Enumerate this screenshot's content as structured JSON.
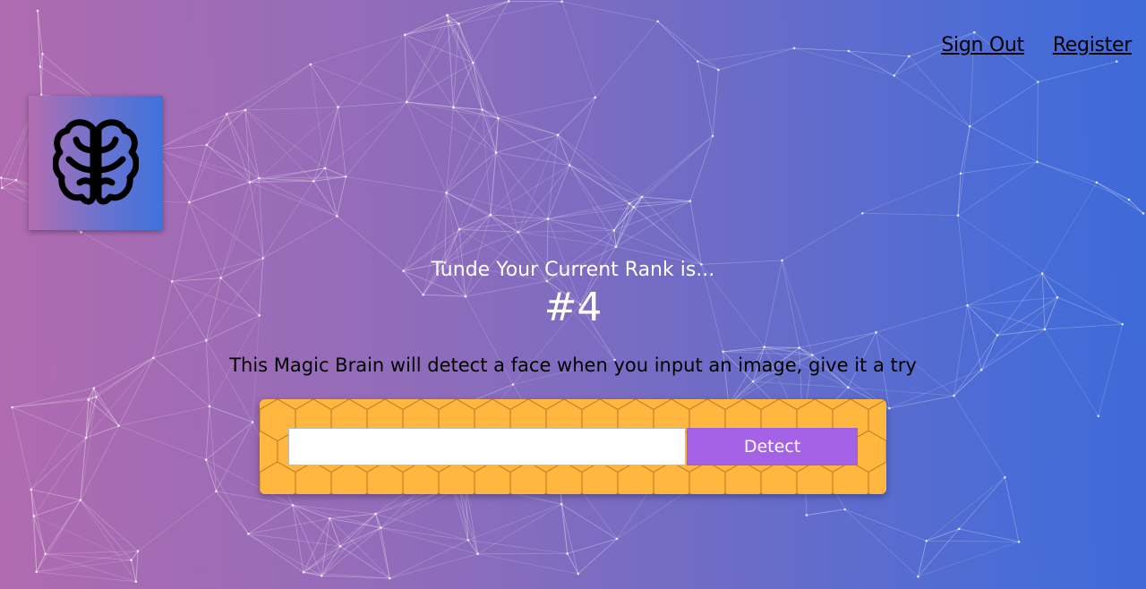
{
  "nav": {
    "sign_out": "Sign Out",
    "register": "Register"
  },
  "logo": {
    "icon": "brain-icon"
  },
  "rank": {
    "label": "Tunde Your Current Rank is...",
    "value": "#4"
  },
  "intro": {
    "text": "This Magic Brain will detect a face when you input an image, give it a try"
  },
  "form": {
    "input_value": "",
    "input_placeholder": "",
    "detect_label": "Detect"
  },
  "colors": {
    "gradient_start": "#b06bb0",
    "gradient_end": "#3e6ad8",
    "card_bg": "#ffb73f",
    "button_bg": "#a463e6"
  }
}
